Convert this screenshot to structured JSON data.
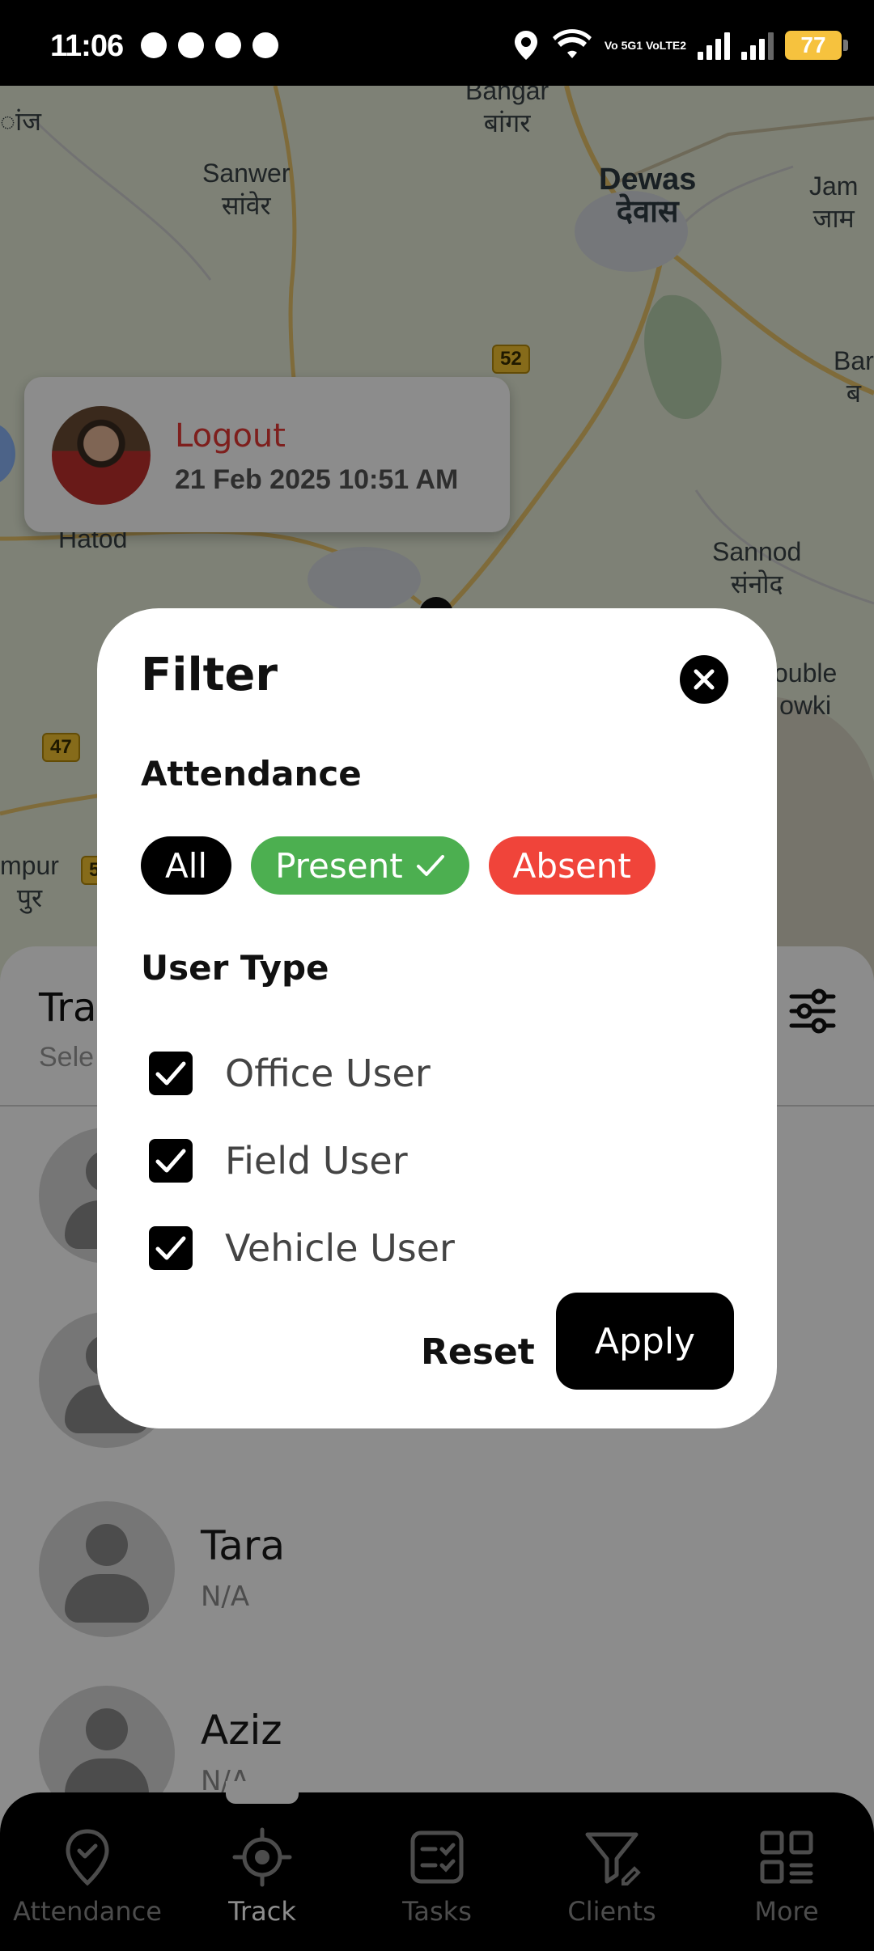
{
  "status_bar": {
    "time": "11:06",
    "battery": "77",
    "network_label": "Vo 5G1 VoLTE2"
  },
  "map": {
    "labels": [
      {
        "text": "Bangar",
        "sub": "बांगर"
      },
      {
        "text": "Sanwer",
        "sub": "सांवेर"
      },
      {
        "text": "Dewas",
        "sub": "देवास"
      },
      {
        "text": "Jam",
        "sub": "जाम"
      },
      {
        "text": "Bar",
        "sub": "ब"
      },
      {
        "text": "Hatod",
        "sub": ""
      },
      {
        "text": "Sannod",
        "sub": "संनोद"
      },
      {
        "text": "ouble",
        "sub": "owki"
      },
      {
        "text": "mpur",
        "sub": "पुर"
      },
      {
        "text": "ांज",
        "sub": ""
      }
    ],
    "highway_shields": [
      "52",
      "47",
      "5"
    ]
  },
  "marker_card": {
    "title": "Logout",
    "time": "21 Feb 2025 10:51 AM"
  },
  "sheet": {
    "title": "Tra",
    "subtitle": "Sele",
    "people": [
      {
        "name": "",
        "sub": ""
      },
      {
        "name": "",
        "sub": ""
      },
      {
        "name": "Tara",
        "sub": "N/A"
      },
      {
        "name": "Aziz",
        "sub": "N/A"
      }
    ]
  },
  "modal": {
    "title": "Filter",
    "attendance_title": "Attendance",
    "chips": {
      "all": "All",
      "present": "Present",
      "absent": "Absent"
    },
    "user_type_title": "User Type",
    "user_types": [
      {
        "label": "Office User",
        "checked": true
      },
      {
        "label": "Field User",
        "checked": true
      },
      {
        "label": "Vehicle User",
        "checked": true
      }
    ],
    "reset_label": "Reset",
    "apply_label": "Apply"
  },
  "nav": {
    "items": [
      {
        "label": "Attendance",
        "icon": "location-check-icon"
      },
      {
        "label": "Track",
        "icon": "crosshair-icon"
      },
      {
        "label": "Tasks",
        "icon": "task-list-icon"
      },
      {
        "label": "Clients",
        "icon": "filter-edit-icon"
      },
      {
        "label": "More",
        "icon": "grid-more-icon"
      }
    ],
    "active": "Track"
  },
  "colors": {
    "present": "#4caf50",
    "absent": "#f0443a",
    "logout": "#e53935",
    "battery": "#f6c23e"
  }
}
